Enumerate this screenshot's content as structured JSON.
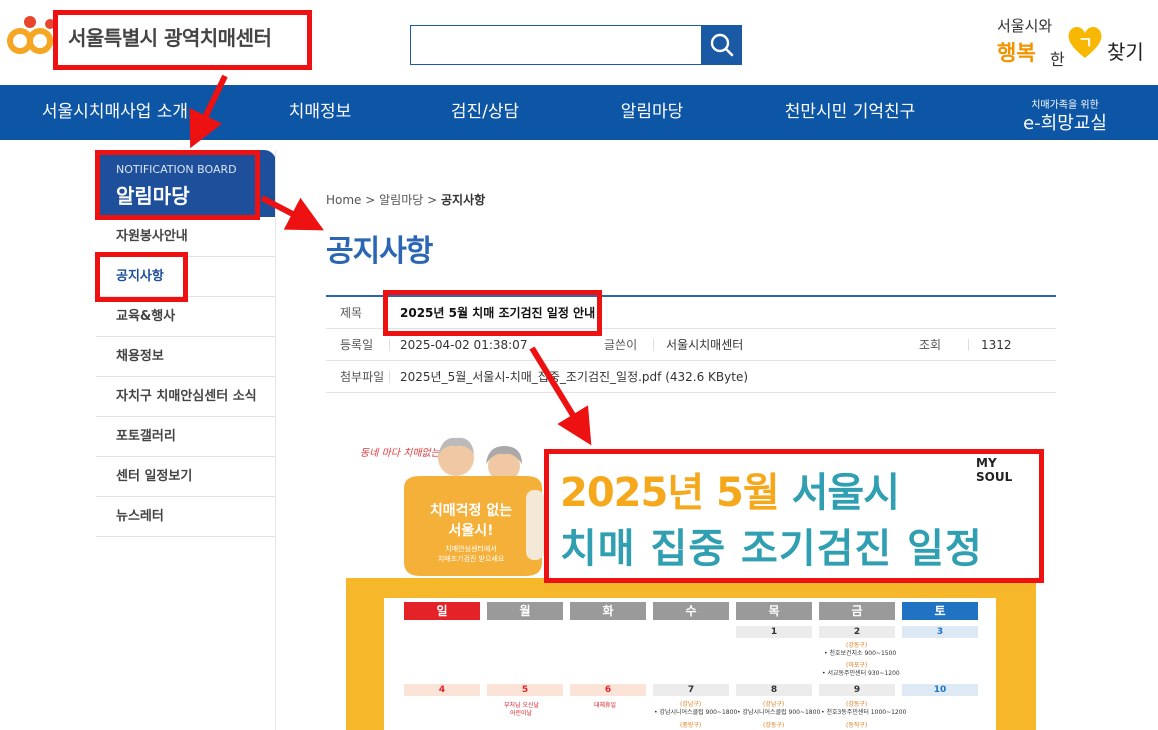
{
  "header": {
    "logo_text": "서울특별시 광역치매센터",
    "search_placeholder": "",
    "happy_line1": "서울시와",
    "happy_line2": "행복",
    "happy_line3": "한",
    "happy_line4": "찾기"
  },
  "nav": {
    "items": [
      "서울시치매사업 소개",
      "치매정보",
      "검진/상담",
      "알림마당",
      "천만시민 기억친구"
    ],
    "e_small": "치매가족을 위한",
    "e_big": "e-희망교실"
  },
  "sidebar": {
    "eng": "NOTIFICATION BOARD",
    "title": "알림마당",
    "items": [
      "자원봉사안내",
      "공지사항",
      "교육&행사",
      "채용정보",
      "자치구 치매안심센터 소식",
      "포토갤러리",
      "센터 일정보기",
      "뉴스레터"
    ],
    "active_index": 1
  },
  "breadcrumb": {
    "home": "Home",
    "sep1": " > ",
    "mid": "알림마당",
    "sep2": " > ",
    "current": "공지사항"
  },
  "page_title": "공지사항",
  "post": {
    "subject_label": "제목",
    "subject": "2025년 5월 치매 조기검진 일정 안내",
    "date_label": "등록일",
    "date": "2025-04-02 01:38:07",
    "writer_label": "글쓴이",
    "writer": "서울시치매센터",
    "views_label": "조회",
    "views": "1312",
    "attach_label": "첨부파일",
    "attach": "2025년_5월_서울시-치매_집중_조기검진_일정.pdf (432.6 KByte)"
  },
  "poster": {
    "slogan": "동네 마다 치매없는 서울",
    "bubble_title1": "치매걱정 없는",
    "bubble_title2": "서울시!",
    "bubble_sub1": "치매안심센터에서",
    "bubble_sub2": "치매조기검진 받으세요",
    "title_orange": "2025년 5월",
    "title_teal": "서울시",
    "title2": "치매 집중 조기검진 일정",
    "brand": "MY SOUL",
    "weekdays": [
      "일",
      "월",
      "화",
      "수",
      "목",
      "금",
      "토"
    ],
    "week1": [
      "",
      "",
      "",
      "",
      "1",
      "2",
      "3"
    ],
    "week2": [
      "4",
      "5",
      "6",
      "7",
      "8",
      "9",
      "10"
    ],
    "notes": {
      "fri1_gu1": "(강동구)",
      "fri1_t1": "• 천호보건지소 900~1500",
      "fri1_gu2": "(마포구)",
      "fri1_t2": "• 서교동주민센터 930~1200",
      "mon2": "부처님 오신날",
      "mon2b": "어린이날",
      "tue2": "대체휴일",
      "wed2_gu": "(강남구)",
      "wed2_t": "• 강남시니어스클럽 900~1800",
      "thu2_gu": "(강남구)",
      "thu2_t": "• 강남시니어스클럽 900~1800",
      "fri2_gu": "(강동구)",
      "fri2_t": "• 천호3동주민센터 1000~1200",
      "wed2_gu2": "(중랑구)",
      "thu2_gu2": "(강동구)",
      "fri2_gu2": "(동작구)"
    }
  },
  "colors": {
    "nav": "#0d55a5",
    "accent": "#2a66b3",
    "annotation": "#ee1111",
    "poster_orange": "#f6b82a",
    "poster_teal": "#2f9fb1"
  },
  "icons": [
    "search-icon",
    "logo-icon",
    "heart-icon"
  ]
}
